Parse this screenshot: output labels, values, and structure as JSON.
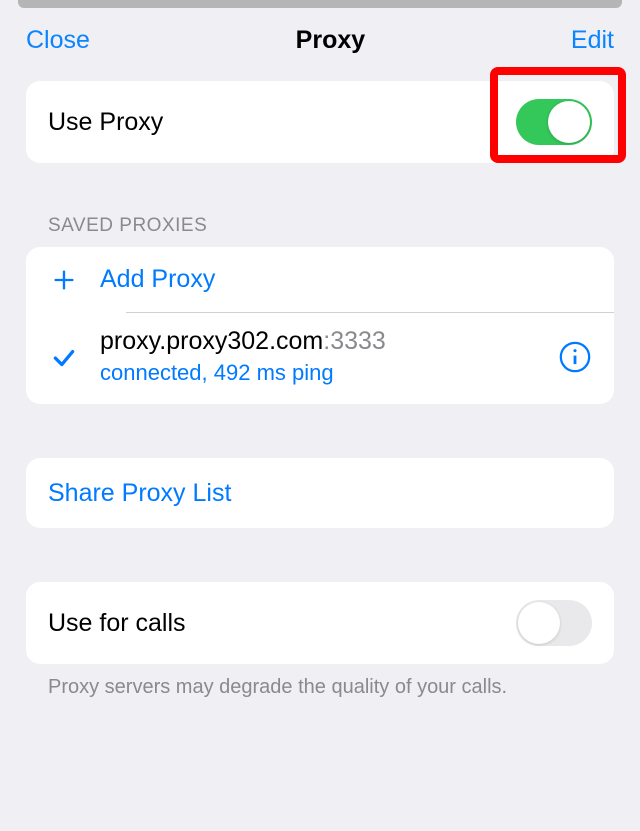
{
  "header": {
    "close": "Close",
    "title": "Proxy",
    "edit": "Edit"
  },
  "useProxy": {
    "label": "Use Proxy",
    "enabled": true
  },
  "savedProxies": {
    "header": "SAVED PROXIES",
    "addLabel": "Add Proxy",
    "items": [
      {
        "host": "proxy.proxy302.com",
        "port": ":3333",
        "status": "connected, 492 ms ping",
        "selected": true
      }
    ]
  },
  "share": {
    "label": "Share Proxy List"
  },
  "calls": {
    "label": "Use for calls",
    "enabled": false,
    "footer": "Proxy servers may degrade the quality of your calls."
  }
}
